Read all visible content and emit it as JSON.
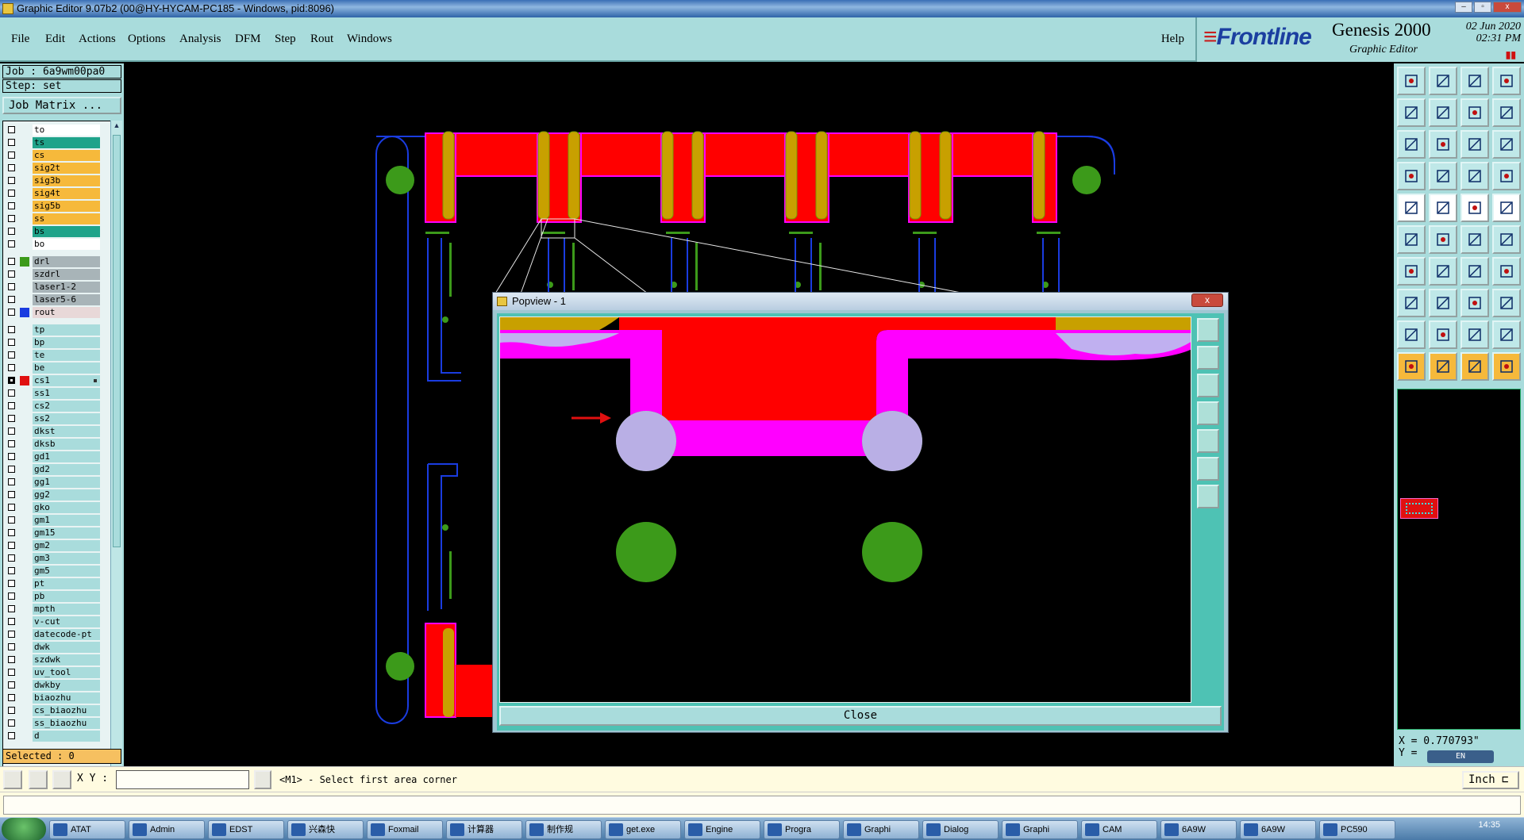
{
  "window": {
    "title": "Graphic Editor 9.07b2 (00@HY-HYCAM-PC185 - Windows, pid:8096)",
    "controls": [
      "–",
      "▫",
      "x"
    ]
  },
  "menu": {
    "items": [
      "File",
      "Edit",
      "Actions",
      "Options",
      "Analysis",
      "DFM",
      "Step",
      "Rout",
      "Windows"
    ],
    "help": "Help"
  },
  "brand": {
    "logo": "Frontline",
    "product": "Genesis 2000",
    "subtitle": "Graphic Editor",
    "date": "02 Jun 2020",
    "time": "02:31 PM",
    "pause_glyph": "▮▮"
  },
  "job": {
    "job_label": "Job : 6a9wm00pa0",
    "step_label": "Step: set",
    "matrix_button": "Job Matrix ..."
  },
  "layers": [
    {
      "name": "to",
      "color": "#ffffff",
      "sw": ""
    },
    {
      "name": "ts",
      "color": "#1fa38a",
      "sw": ""
    },
    {
      "name": "cs",
      "color": "#f6b93b",
      "sw": ""
    },
    {
      "name": "sig2t",
      "color": "#f6b93b",
      "sw": ""
    },
    {
      "name": "sig3b",
      "color": "#f6b93b",
      "sw": ""
    },
    {
      "name": "sig4t",
      "color": "#f6b93b",
      "sw": ""
    },
    {
      "name": "sig5b",
      "color": "#f6b93b",
      "sw": ""
    },
    {
      "name": "ss",
      "color": "#f6b93b",
      "sw": ""
    },
    {
      "name": "bs",
      "color": "#1fa38a",
      "sw": ""
    },
    {
      "name": "bo",
      "color": "#ffffff",
      "sw": ""
    },
    {
      "name": "drl",
      "color": "#a8b4b8",
      "sw": "#3c9a1a"
    },
    {
      "name": "szdrl",
      "color": "#a8b4b8",
      "sw": ""
    },
    {
      "name": "laser1-2",
      "color": "#a8b4b8",
      "sw": ""
    },
    {
      "name": "laser5-6",
      "color": "#a8b4b8",
      "sw": ""
    },
    {
      "name": "rout",
      "color": "#e8d8d8",
      "sw": "#1a3ce0"
    },
    {
      "name": "tp",
      "color": "#a9dcdc",
      "sw": ""
    },
    {
      "name": "bp",
      "color": "#a9dcdc",
      "sw": ""
    },
    {
      "name": "te",
      "color": "#a9dcdc",
      "sw": ""
    },
    {
      "name": "be",
      "color": "#a9dcdc",
      "sw": ""
    },
    {
      "name": "cs1",
      "color": "#a9dcdc",
      "sw": "#e01010",
      "on": true,
      "mark": true
    },
    {
      "name": "ss1",
      "color": "#a9dcdc",
      "sw": ""
    },
    {
      "name": "cs2",
      "color": "#a9dcdc",
      "sw": ""
    },
    {
      "name": "ss2",
      "color": "#a9dcdc",
      "sw": ""
    },
    {
      "name": "dkst",
      "color": "#a9dcdc",
      "sw": ""
    },
    {
      "name": "dksb",
      "color": "#a9dcdc",
      "sw": ""
    },
    {
      "name": "gd1",
      "color": "#a9dcdc",
      "sw": ""
    },
    {
      "name": "gd2",
      "color": "#a9dcdc",
      "sw": ""
    },
    {
      "name": "gg1",
      "color": "#a9dcdc",
      "sw": ""
    },
    {
      "name": "gg2",
      "color": "#a9dcdc",
      "sw": ""
    },
    {
      "name": "gko",
      "color": "#a9dcdc",
      "sw": ""
    },
    {
      "name": "gm1",
      "color": "#a9dcdc",
      "sw": ""
    },
    {
      "name": "gm15",
      "color": "#a9dcdc",
      "sw": ""
    },
    {
      "name": "gm2",
      "color": "#a9dcdc",
      "sw": ""
    },
    {
      "name": "gm3",
      "color": "#a9dcdc",
      "sw": ""
    },
    {
      "name": "gm5",
      "color": "#a9dcdc",
      "sw": ""
    },
    {
      "name": "pt",
      "color": "#a9dcdc",
      "sw": ""
    },
    {
      "name": "pb",
      "color": "#a9dcdc",
      "sw": ""
    },
    {
      "name": "mpth",
      "color": "#a9dcdc",
      "sw": ""
    },
    {
      "name": "v-cut",
      "color": "#a9dcdc",
      "sw": ""
    },
    {
      "name": "datecode-pt",
      "color": "#a9dcdc",
      "sw": ""
    },
    {
      "name": "dwk",
      "color": "#a9dcdc",
      "sw": ""
    },
    {
      "name": "szdwk",
      "color": "#a9dcdc",
      "sw": ""
    },
    {
      "name": "uv_tool",
      "color": "#a9dcdc",
      "sw": ""
    },
    {
      "name": "dwkby",
      "color": "#a9dcdc",
      "sw": ""
    },
    {
      "name": "biaozhu",
      "color": "#a9dcdc",
      "sw": ""
    },
    {
      "name": "cs_biaozhu",
      "color": "#a9dcdc",
      "sw": ""
    },
    {
      "name": "ss_biaozhu",
      "color": "#a9dcdc",
      "sw": ""
    },
    {
      "name": "d",
      "color": "#a9dcdc",
      "sw": ""
    }
  ],
  "selected": "Selected : 0",
  "popview": {
    "title": "Popview - 1",
    "close_label": "Close",
    "close_x": "x"
  },
  "command": {
    "xy_label": "X Y :",
    "xy_value": "",
    "prompt": "<M1> - Select first area corner",
    "unit": "Inch ⊏"
  },
  "coords": {
    "x": "X = 0.770793\"",
    "y": "Y =",
    "ime": "EN"
  },
  "taskbar": {
    "items": [
      "ATAT",
      "Admin",
      "EDST",
      "兴森快",
      "Foxmail",
      "计算器",
      "制作规",
      "get.exe",
      "Engine",
      "Progra",
      "Graphi",
      "Dialog",
      "Graphi",
      "CAM",
      "6A9W",
      "6A9W",
      "PC590"
    ],
    "time": "14:35"
  },
  "colors": {
    "panel": "#a9dcdc",
    "copper": "#ff0000",
    "mask": "#ff00ff",
    "drill": "#3c9a1a",
    "rout": "#1a3ce0",
    "gold": "#c8a000"
  },
  "tool_icons": [
    "home-icon",
    "zoom-icon",
    "measure-icon",
    "select-icon",
    "line-icon",
    "arc-icon"
  ]
}
